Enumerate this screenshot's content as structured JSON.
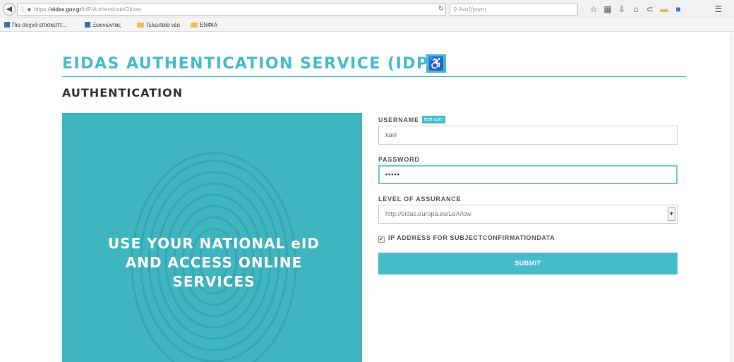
{
  "browser": {
    "url_scheme": "https://",
    "url_host": "eidas.gov.gr",
    "url_path": "/IdP/AuthenticateCitizen",
    "search_placeholder": "Αναζήτηση",
    "bookmarks": [
      {
        "label": "Πιο συχνά επισκεπτ...",
        "icon": "blue"
      },
      {
        "label": "Ξεκινώντας",
        "icon": "blue"
      },
      {
        "label": "Τελευταία νέα",
        "icon": "folder"
      },
      {
        "label": "ΕΝΦΙΑ",
        "icon": "folder"
      }
    ]
  },
  "header": {
    "title": "EIDAS AUTHENTICATION SERVICE (IDP)"
  },
  "section": {
    "title": "AUTHENTICATION"
  },
  "hero": {
    "line1": "USE YOUR NATIONAL eID",
    "line2": "AND ACCESS ONLINE",
    "line3": "SERVICES"
  },
  "form": {
    "username_label": "USERNAME",
    "username_badge": "test user",
    "username_value": "xavi",
    "password_label": "PASSWORD",
    "password_value": "•••••",
    "loa_label": "LEVEL OF ASSURANCE",
    "loa_value": "http://eidas.europa.eu/LoA/low",
    "ip_checkbox_label": "IP ADDRESS FOR SUBJECTCONFIRMATIONDATA",
    "ip_checked": true,
    "submit_label": "SUBMIT"
  },
  "colors": {
    "accent": "#45bcc9",
    "hero_bg": "#3fb5bf"
  }
}
